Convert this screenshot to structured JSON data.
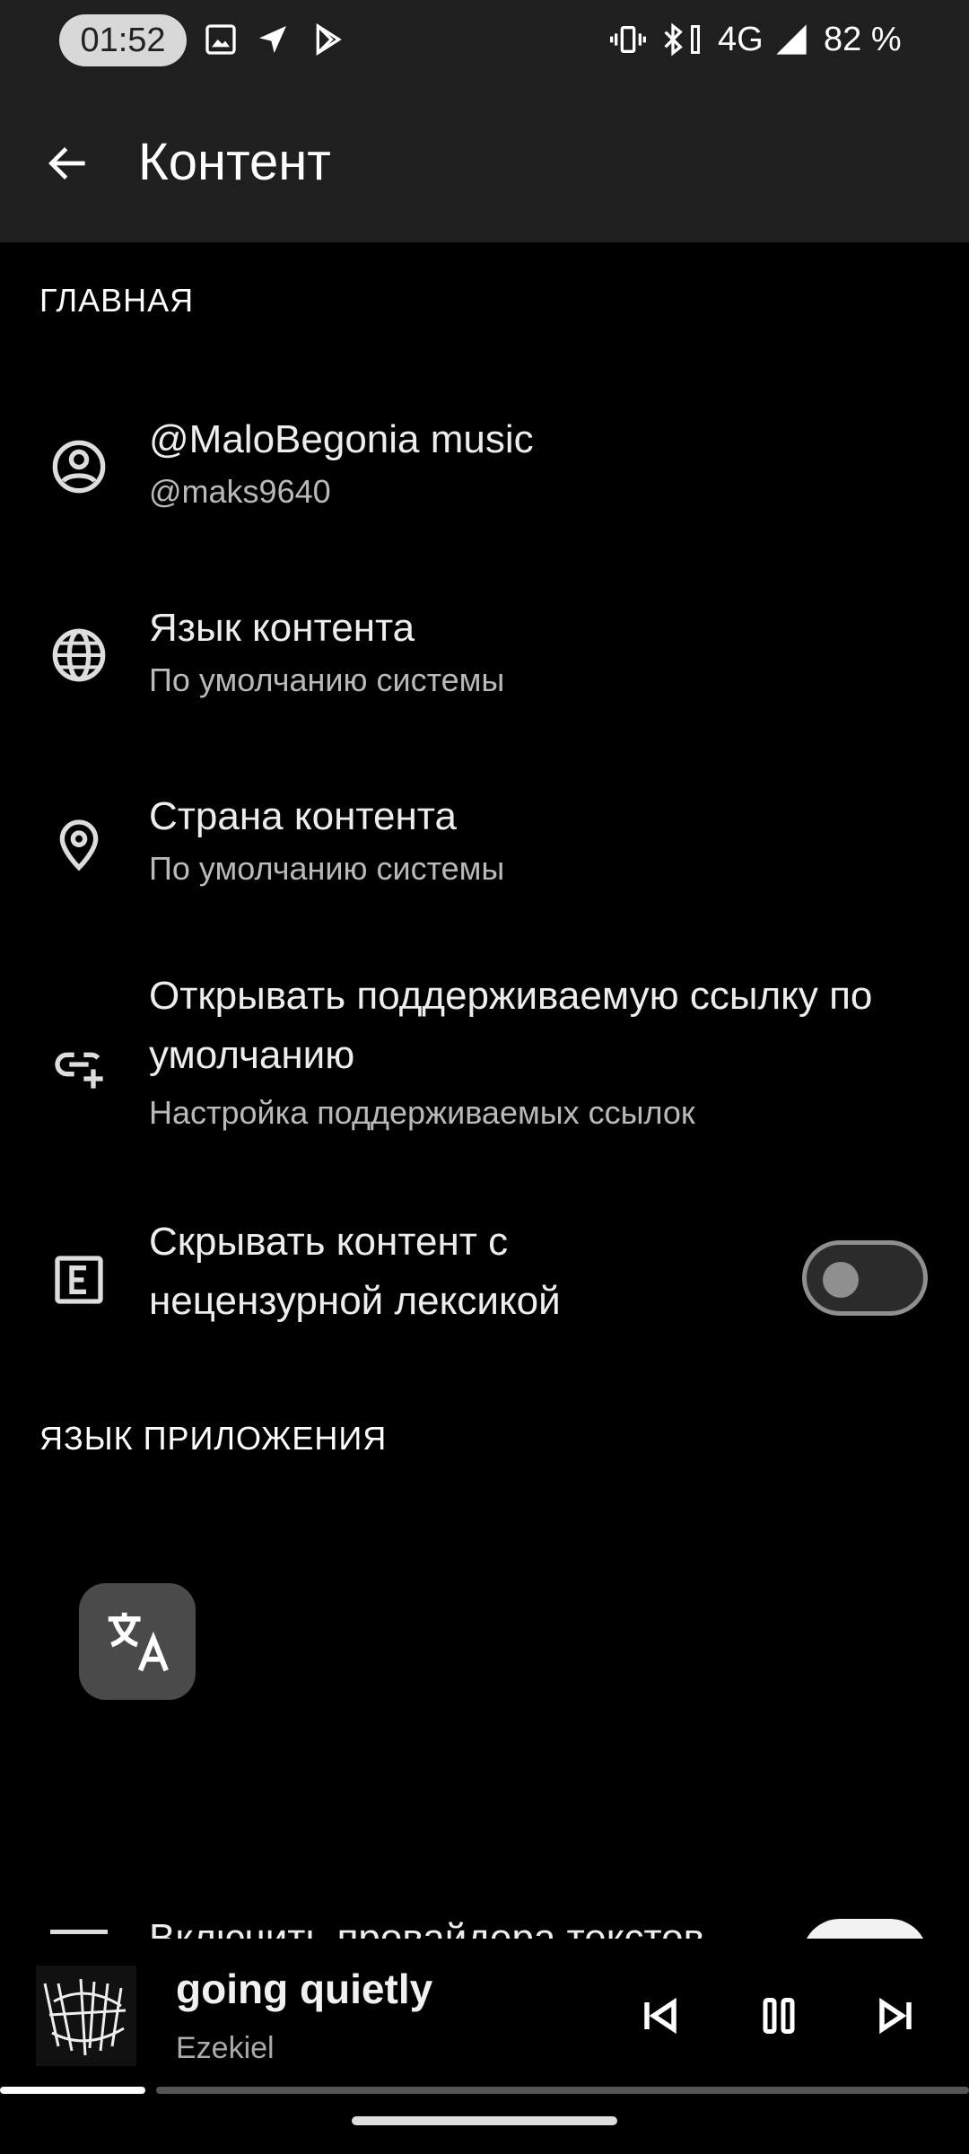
{
  "status_bar": {
    "time": "01:52",
    "left_icons": [
      "gallery-icon",
      "navigation-icon",
      "play-store-icon"
    ],
    "right_icons": [
      "vibrate-icon",
      "bluetooth-icon"
    ],
    "network": "4G",
    "battery": "82 %"
  },
  "app_bar": {
    "title": "Контент"
  },
  "sections": {
    "main_header": "ГЛАВНАЯ",
    "app_language_header": "ЯЗЫК ПРИЛОЖЕНИЯ"
  },
  "items": [
    {
      "title": "@MaloBegonia music",
      "subtitle": "@maks9640",
      "icon": "account-circle-icon"
    },
    {
      "title": "Язык контента",
      "subtitle": "По умолчанию системы",
      "icon": "globe-icon"
    },
    {
      "title": "Страна контента",
      "subtitle": "По умолчанию системы",
      "icon": "location-icon"
    },
    {
      "title_line1": "Открывать поддерживаемую ссылку по",
      "title_line2": "умолчанию",
      "subtitle": "Настройка поддерживаемых ссылок",
      "icon": "add-link-icon"
    },
    {
      "title_line1": "Скрывать контент с",
      "title_line2": "нецензурной лексикой",
      "icon": "explicit-icon",
      "toggle_on": false
    }
  ],
  "partial_item": {
    "title": "Включить провайдера текстов",
    "toggle_on": true
  },
  "now_playing": {
    "title": "going quietly",
    "artist": "Ezekiel",
    "progress": 0.15
  }
}
